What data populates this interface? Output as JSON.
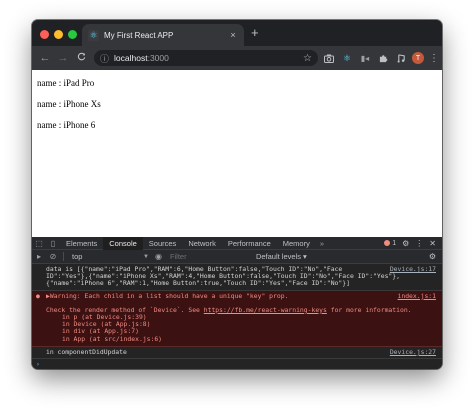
{
  "browser": {
    "tab_title": "My First React APP",
    "tab_close": "×",
    "new_tab": "+",
    "nav_back": "←",
    "nav_forward": "→",
    "nav_reload": "C",
    "url_host": "localhost",
    "url_port": ":3000",
    "star": "☆",
    "profile_initial": "T",
    "menu": "⋮"
  },
  "page": {
    "lines": [
      "name : iPad Pro",
      "name : iPhone Xs",
      "name : iPhone 6"
    ]
  },
  "devtools": {
    "tabs": [
      "Elements",
      "Console",
      "Sources",
      "Network",
      "Performance",
      "Memory"
    ],
    "active_tab": "Console",
    "more_tabs": "»",
    "error_count": "1",
    "context": "top",
    "filter_placeholder": "Filter",
    "levels": "Default levels ▾",
    "log1": {
      "lines": [
        "data is [{\"name\":\"iPad Pro\",\"RAM\":6,\"Home Button\":false,\"Touch ID\":\"No\",\"Face",
        "ID\":\"Yes\"},{\"name\":\"iPhone Xs\",\"RAM\":4,\"Home Button\":false,\"Touch ID\":\"No\",\"Face ID\":\"Yes\"},",
        "{\"name\":\"iPhone 6\",\"RAM\":1,\"Home Button\":true,\"Touch ID\":\"Yes\",\"Face ID\":\"No\"}]"
      ],
      "source": "Device.js:17"
    },
    "error": {
      "message": "▶Warning: Each child in a list should have a unique \"key\" prop.",
      "source": "index.js:1",
      "check_prefix": "Check the render method of `Device`. See ",
      "check_link": "https://fb.me/react-warning-keys",
      "check_suffix": " for more information.",
      "stack": [
        "in p (at Device.js:39)",
        "in Device (at App.js:8)",
        "in div (at App.js:7)",
        "in App (at src/index.js:6)"
      ]
    },
    "log2": {
      "text": "in componentDidUpdate",
      "source": "Device.js:27"
    },
    "prompt": "›"
  },
  "colors": {
    "close": "#ff5f57",
    "minimize": "#febc2e",
    "maximize": "#28c840",
    "error_text": "#f28b82",
    "error_bg": "#3c1111",
    "react_blue": "#61dafb"
  }
}
